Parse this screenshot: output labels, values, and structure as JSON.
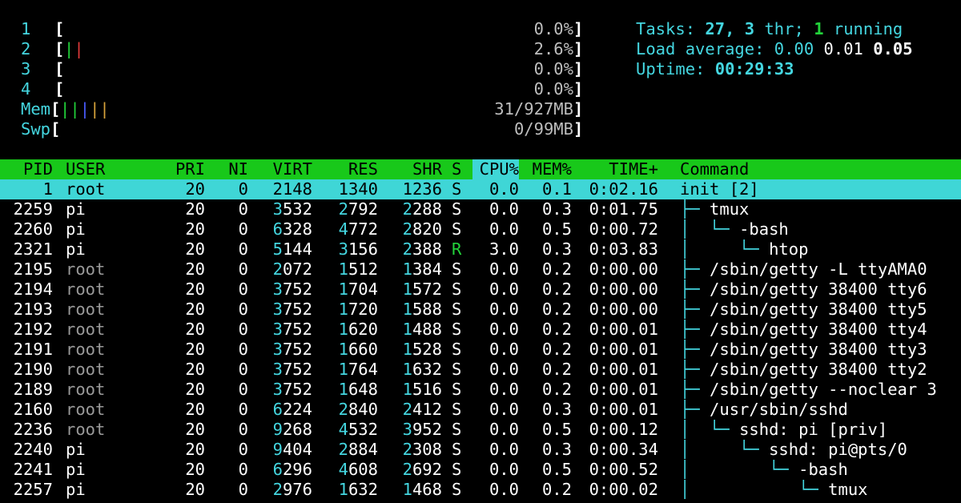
{
  "meters": [
    {
      "label": "1",
      "bars": [],
      "value": "0.0%"
    },
    {
      "label": "2",
      "bars": [
        {
          "c": "green"
        },
        {
          "c": "red"
        }
      ],
      "value": "2.6%"
    },
    {
      "label": "3",
      "bars": [],
      "value": "0.0%"
    },
    {
      "label": "4",
      "bars": [],
      "value": "0.0%"
    },
    {
      "label": "Mem",
      "bars": [
        {
          "c": "green"
        },
        {
          "c": "green"
        },
        {
          "c": "blue"
        },
        {
          "c": "yellow"
        },
        {
          "c": "yellow"
        }
      ],
      "value": "31/927MB"
    },
    {
      "label": "Swp",
      "bars": [],
      "value": "0/99MB"
    }
  ],
  "summary": {
    "tasks_label": "Tasks: ",
    "tasks": "27",
    "thr_sep": ", ",
    "thr": "3",
    "thr_label": " thr; ",
    "running": "1",
    "running_label": " running",
    "load_label": "Load average: ",
    "load1": "0.00",
    "load5": "0.01",
    "load15": "0.05",
    "uptime_label": "Uptime: ",
    "uptime": "00:29:33"
  },
  "columns": {
    "pid": "PID",
    "user": "USER",
    "pri": "PRI",
    "ni": "NI",
    "virt": "VIRT",
    "res": "RES",
    "shr": "SHR",
    "s": "S",
    "cpu": "CPU%",
    "mem": "MEM%",
    "time": "TIME+",
    "command": "Command"
  },
  "processes": [
    {
      "pid": "1",
      "user": "root",
      "pri": "20",
      "ni": "0",
      "virt": "2148",
      "res": "1340",
      "shr": "1236",
      "s": "S",
      "cpu": "0.0",
      "mem": "0.1",
      "time": "0:02.16",
      "tree": "",
      "cmd": "init [2]",
      "selected": true
    },
    {
      "pid": "2259",
      "user": "pi",
      "pri": "20",
      "ni": "0",
      "virt": "3532",
      "res": "2792",
      "shr": "2288",
      "s": "S",
      "cpu": "0.0",
      "mem": "0.3",
      "time": "0:01.75",
      "tree": "├─ ",
      "cmd": "tmux"
    },
    {
      "pid": "2260",
      "user": "pi",
      "pri": "20",
      "ni": "0",
      "virt": "6328",
      "res": "4772",
      "shr": "2820",
      "s": "S",
      "cpu": "0.0",
      "mem": "0.5",
      "time": "0:00.72",
      "tree": "│  └─ ",
      "cmd": "-bash"
    },
    {
      "pid": "2321",
      "user": "pi",
      "pri": "20",
      "ni": "0",
      "virt": "5144",
      "res": "3156",
      "shr": "2388",
      "s": "R",
      "cpu": "3.0",
      "mem": "0.3",
      "time": "0:03.83",
      "tree": "│     └─ ",
      "cmd": "htop"
    },
    {
      "pid": "2195",
      "user": "root",
      "pri": "20",
      "ni": "0",
      "virt": "2072",
      "res": "1512",
      "shr": "1384",
      "s": "S",
      "cpu": "0.0",
      "mem": "0.2",
      "time": "0:00.00",
      "tree": "├─ ",
      "cmd": "/sbin/getty -L ttyAMA0"
    },
    {
      "pid": "2194",
      "user": "root",
      "pri": "20",
      "ni": "0",
      "virt": "3752",
      "res": "1704",
      "shr": "1572",
      "s": "S",
      "cpu": "0.0",
      "mem": "0.2",
      "time": "0:00.00",
      "tree": "├─ ",
      "cmd": "/sbin/getty 38400 tty6"
    },
    {
      "pid": "2193",
      "user": "root",
      "pri": "20",
      "ni": "0",
      "virt": "3752",
      "res": "1720",
      "shr": "1588",
      "s": "S",
      "cpu": "0.0",
      "mem": "0.2",
      "time": "0:00.00",
      "tree": "├─ ",
      "cmd": "/sbin/getty 38400 tty5"
    },
    {
      "pid": "2192",
      "user": "root",
      "pri": "20",
      "ni": "0",
      "virt": "3752",
      "res": "1620",
      "shr": "1488",
      "s": "S",
      "cpu": "0.0",
      "mem": "0.2",
      "time": "0:00.01",
      "tree": "├─ ",
      "cmd": "/sbin/getty 38400 tty4"
    },
    {
      "pid": "2191",
      "user": "root",
      "pri": "20",
      "ni": "0",
      "virt": "3752",
      "res": "1660",
      "shr": "1528",
      "s": "S",
      "cpu": "0.0",
      "mem": "0.2",
      "time": "0:00.01",
      "tree": "├─ ",
      "cmd": "/sbin/getty 38400 tty3"
    },
    {
      "pid": "2190",
      "user": "root",
      "pri": "20",
      "ni": "0",
      "virt": "3752",
      "res": "1764",
      "shr": "1632",
      "s": "S",
      "cpu": "0.0",
      "mem": "0.2",
      "time": "0:00.01",
      "tree": "├─ ",
      "cmd": "/sbin/getty 38400 tty2"
    },
    {
      "pid": "2189",
      "user": "root",
      "pri": "20",
      "ni": "0",
      "virt": "3752",
      "res": "1648",
      "shr": "1516",
      "s": "S",
      "cpu": "0.0",
      "mem": "0.2",
      "time": "0:00.01",
      "tree": "├─ ",
      "cmd": "/sbin/getty --noclear 3"
    },
    {
      "pid": "2160",
      "user": "root",
      "pri": "20",
      "ni": "0",
      "virt": "6224",
      "res": "2840",
      "shr": "2412",
      "s": "S",
      "cpu": "0.0",
      "mem": "0.3",
      "time": "0:00.01",
      "tree": "├─ ",
      "cmd": "/usr/sbin/sshd"
    },
    {
      "pid": "2236",
      "user": "root",
      "pri": "20",
      "ni": "0",
      "virt": "9268",
      "res": "4532",
      "shr": "3952",
      "s": "S",
      "cpu": "0.0",
      "mem": "0.5",
      "time": "0:00.12",
      "tree": "│  └─ ",
      "cmd": "sshd: pi [priv]"
    },
    {
      "pid": "2240",
      "user": "pi",
      "pri": "20",
      "ni": "0",
      "virt": "9404",
      "res": "2884",
      "shr": "2308",
      "s": "S",
      "cpu": "0.0",
      "mem": "0.3",
      "time": "0:00.34",
      "tree": "│     └─ ",
      "cmd": "sshd: pi@pts/0"
    },
    {
      "pid": "2241",
      "user": "pi",
      "pri": "20",
      "ni": "0",
      "virt": "6296",
      "res": "4608",
      "shr": "2692",
      "s": "S",
      "cpu": "0.0",
      "mem": "0.5",
      "time": "0:00.52",
      "tree": "│        └─ ",
      "cmd": "-bash"
    },
    {
      "pid": "2257",
      "user": "pi",
      "pri": "20",
      "ni": "0",
      "virt": "2976",
      "res": "1632",
      "shr": "1468",
      "s": "S",
      "cpu": "0.0",
      "mem": "0.2",
      "time": "0:00.02",
      "tree": "│           └─ ",
      "cmd": "tmux"
    }
  ]
}
